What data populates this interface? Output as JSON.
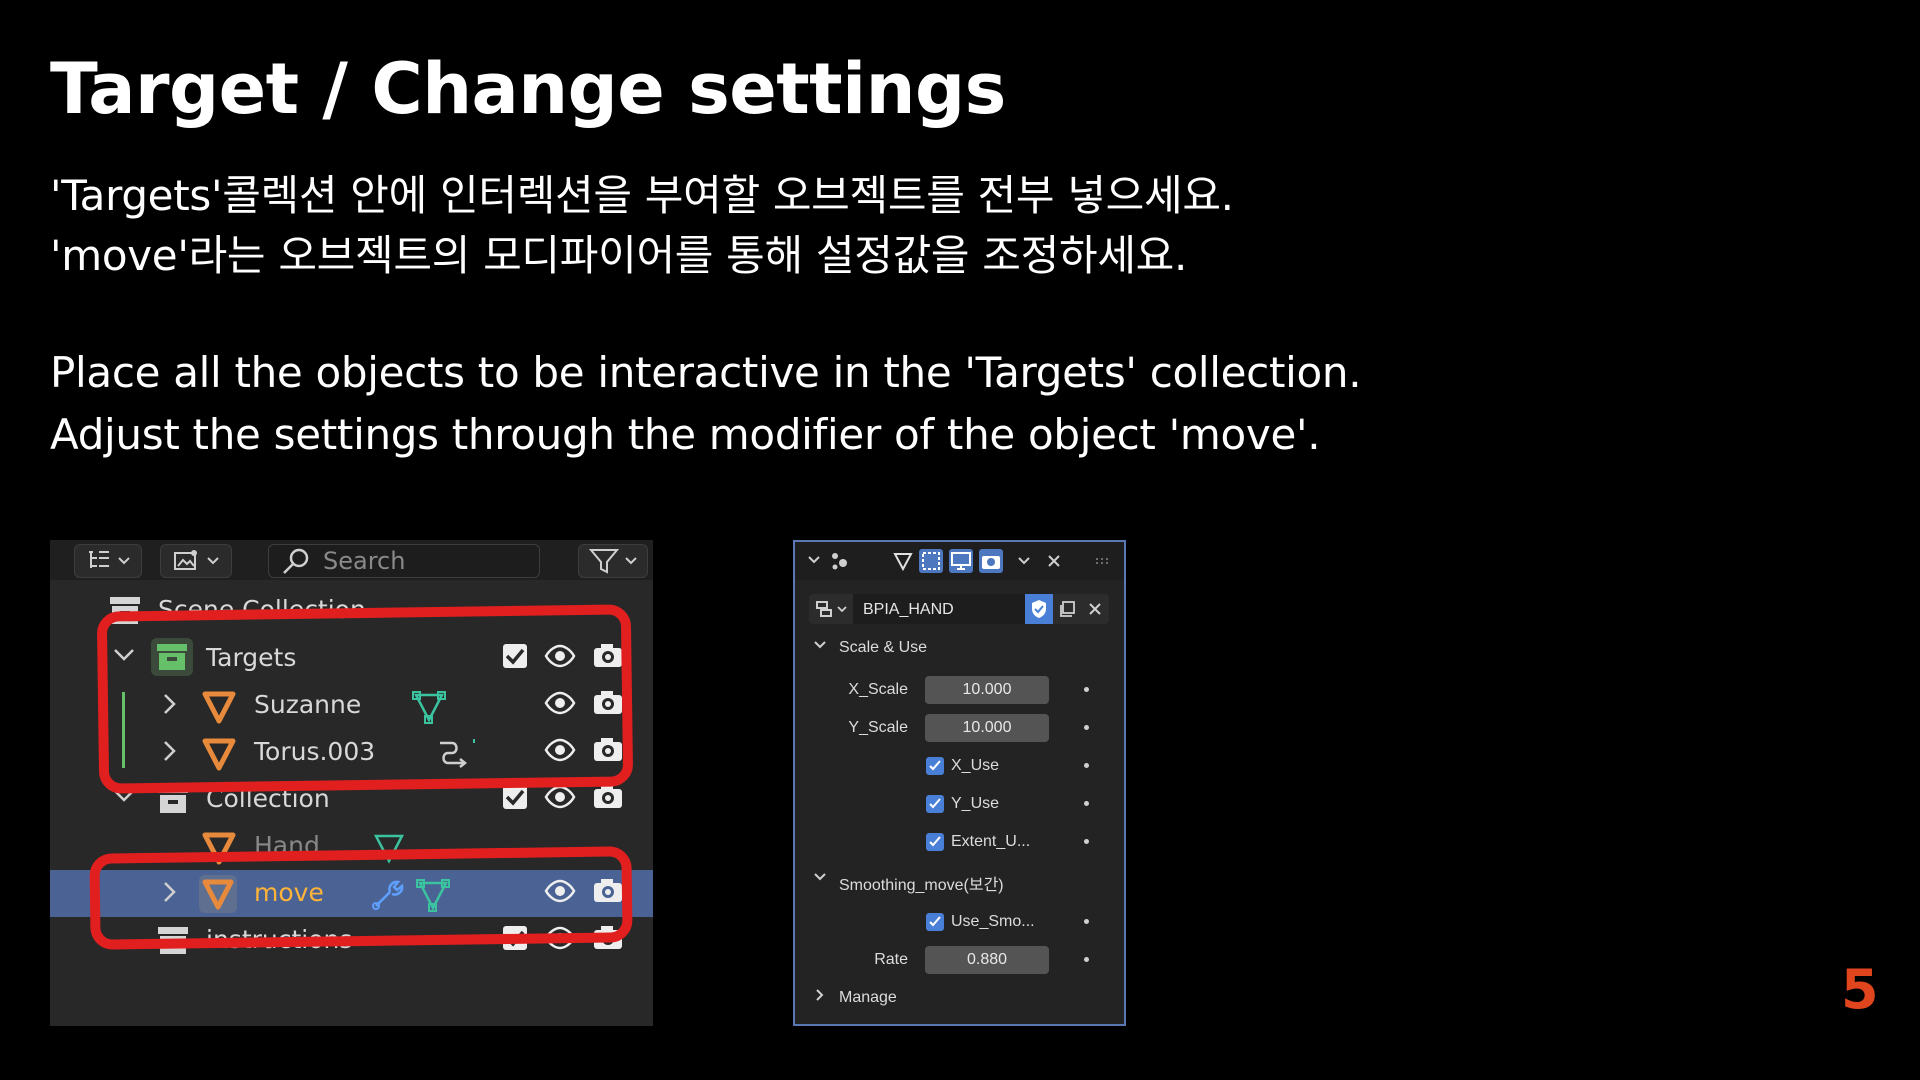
{
  "title": "Target / Change settings",
  "instructions": {
    "ko_1": "'Targets'콜렉션 안에 인터렉션을 부여할 오브젝트를 전부 넣으세요.",
    "ko_2": "'move'라는 오브젝트의 모디파이어를 통해 설정값을 조정하세요.",
    "en_1": "Place all the objects to be interactive in the 'Targets' collection.",
    "en_2": "Adjust the settings through the modifier of the object 'move'."
  },
  "page_number": "5",
  "outliner": {
    "search_placeholder": "Search",
    "items": [
      {
        "label": "Scene Collection"
      },
      {
        "label": "Targets"
      },
      {
        "label": "Suzanne"
      },
      {
        "label": "Torus.003"
      },
      {
        "label": "Collection"
      },
      {
        "label": "Hand"
      },
      {
        "label": "move"
      },
      {
        "label": "instructions"
      }
    ]
  },
  "properties": {
    "object_name": "BPIA_HAND",
    "sections": {
      "scale_use": "Scale & Use",
      "smoothing": "Smoothing_move(보간)",
      "manage": "Manage"
    },
    "fields": {
      "x_scale_label": "X_Scale",
      "x_scale_value": "10.000",
      "y_scale_label": "Y_Scale",
      "y_scale_value": "10.000",
      "x_use_label": "X_Use",
      "y_use_label": "Y_Use",
      "extent_label": "Extent_U...",
      "use_smo_label": "Use_Smo...",
      "rate_label": "Rate",
      "rate_value": "0.880"
    }
  },
  "colors": {
    "annotation_red": "#e11f1f",
    "selection_blue": "#4a6394",
    "accent_orange": "#e0451d",
    "collection_green": "#66c06a"
  }
}
